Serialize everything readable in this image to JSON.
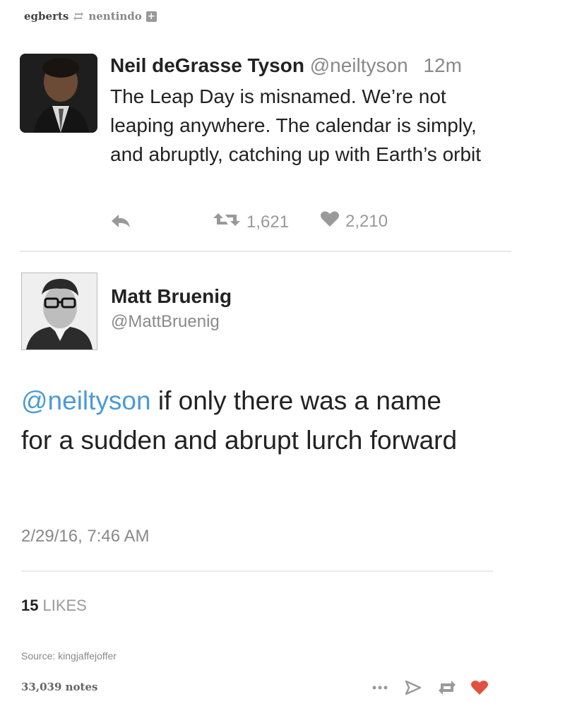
{
  "reblog": {
    "from_user": "egberts",
    "to_user": "nentindo",
    "plus_icon": "+",
    "icons": [
      "reblog-icon",
      "plus-icon"
    ]
  },
  "tweet1": {
    "name": "Neil deGrasse Tyson",
    "handle": "@neiltyson",
    "time": "12m",
    "text": "The Leap Day is misnamed. We’re not leaping anywhere. The calendar is simply, and abruptly, catching up with Earth’s orbit",
    "retweets": "1,621",
    "likes": "2,210",
    "icons": [
      "reply-icon",
      "retweet-icon",
      "heart-icon"
    ]
  },
  "tweet2": {
    "name": "Matt Bruenig",
    "handle": "@MattBruenig",
    "mention": "@neiltyson",
    "text": " if only there was a name for a sudden and abrupt lurch forward",
    "date": "2/29/16, 7:46 AM",
    "likes_count": "15",
    "likes_label": "LIKES"
  },
  "footer": {
    "source": "Source: kingjaffejoffer",
    "notes": "33,039 notes",
    "icons": [
      "more-icon",
      "share-icon",
      "reblog-icon",
      "like-icon"
    ],
    "colors": {
      "heart": "#e0523f",
      "icon_gray": "#9a9a9a",
      "mention_blue": "#4a9bd5"
    }
  }
}
